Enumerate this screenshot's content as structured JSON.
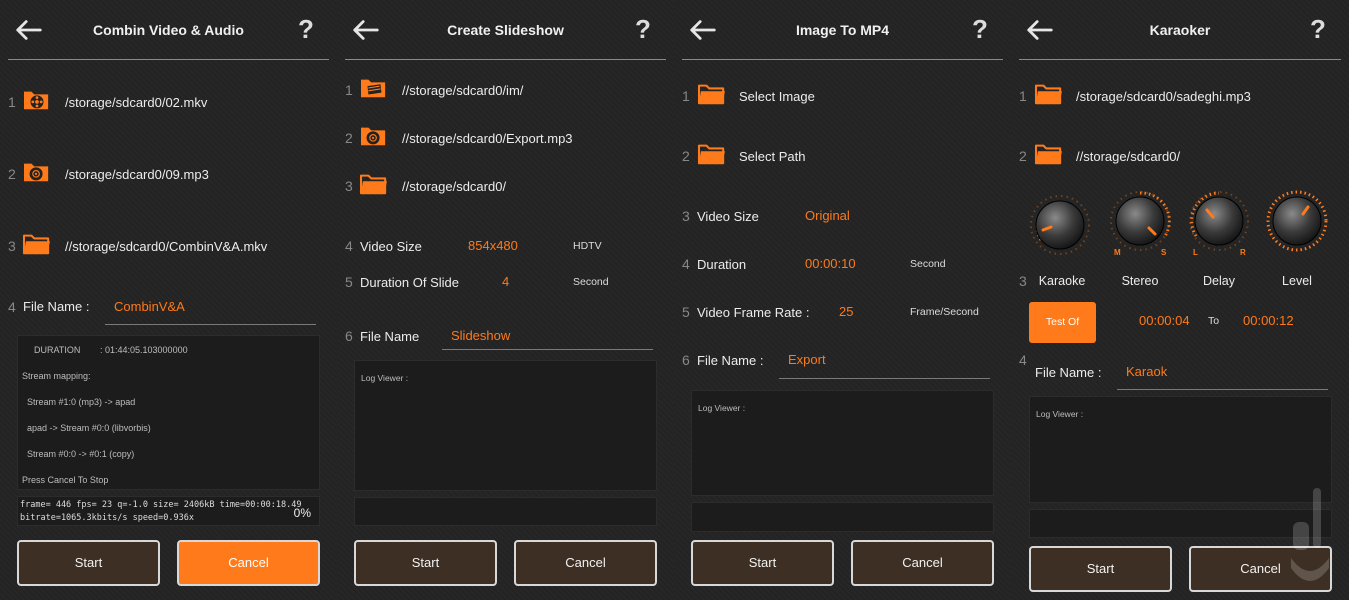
{
  "panel1": {
    "title": "Combin Video & Audio",
    "help": "?",
    "rows": [
      {
        "num": "1",
        "path": "/storage/sdcard0/02.mkv",
        "icon": "video-file-icon"
      },
      {
        "num": "2",
        "path": "/storage/sdcard0/09.mp3",
        "icon": "audio-file-icon"
      },
      {
        "num": "3",
        "path": "//storage/sdcard0/CombinV&A.mkv",
        "icon": "folder-icon"
      }
    ],
    "file_num": "4",
    "file_label": "File Name :",
    "file_value": "CombinV&A",
    "log": {
      "duration_label": "DURATION",
      "duration_value": ": 01:44:05.103000000",
      "lines": [
        "Stream mapping:",
        "Stream #1:0 (mp3) -> apad",
        "apad -> Stream #0:0 (libvorbis)",
        "Stream #0:0 -> #0:1 (copy)",
        "Press Cancel To Stop"
      ]
    },
    "progress": {
      "line1": "frame= 446 fps= 23 q=-1.0 size= 2406kB time=00:00:18.49",
      "line2": "bitrate=1065.3kbits/s speed=0.936x",
      "percent_text": "0%"
    },
    "start": "Start",
    "cancel": "Cancel"
  },
  "panel2": {
    "title": "Create Slideshow",
    "help": "?",
    "rows": [
      {
        "num": "1",
        "path": "//storage/sdcard0/im/",
        "icon": "images-stack-icon"
      },
      {
        "num": "2",
        "path": "//storage/sdcard0/Export.mp3",
        "icon": "audio-file-icon"
      },
      {
        "num": "3",
        "path": "//storage/sdcard0/",
        "icon": "folder-icon"
      }
    ],
    "video_size": {
      "num": "4",
      "label": "Video Size",
      "value": "854x480",
      "unit": "HDTV"
    },
    "slide": {
      "num": "5",
      "label": "Duration Of Slide",
      "value": "4",
      "unit": "Second"
    },
    "file_num": "6",
    "file_label": "File Name",
    "file_value": "Slideshow",
    "log_label": "Log Viewer :",
    "start": "Start",
    "cancel": "Cancel"
  },
  "panel3": {
    "title": "Image To MP4",
    "help": "?",
    "rows": [
      {
        "num": "1",
        "label": "Select Image"
      },
      {
        "num": "2",
        "label": "Select Path"
      }
    ],
    "video_size": {
      "num": "3",
      "label": "Video Size",
      "value": "Original"
    },
    "duration": {
      "num": "4",
      "label": "Duration",
      "value": "00:00:10",
      "unit": "Second"
    },
    "frame_rate": {
      "num": "5",
      "label": "Video Frame Rate :",
      "value": "25",
      "unit": "Frame/Second"
    },
    "file_num": "6",
    "file_label": "File Name :",
    "file_value": "Export",
    "log_label": "Log Viewer :",
    "start": "Start",
    "cancel": "Cancel"
  },
  "panel4": {
    "title": "Karaoker",
    "help": "?",
    "rows": [
      {
        "num": "1",
        "path": "/storage/sdcard0/sadeghi.mp3"
      },
      {
        "num": "2",
        "path": "//storage/sdcard0/"
      }
    ],
    "knobs_num": "3",
    "knobs": [
      {
        "label": "Karaoke"
      },
      {
        "label": "Stereo",
        "left_mark": "M",
        "right_mark": "S"
      },
      {
        "label": "Delay",
        "left_mark": "L",
        "right_mark": "R"
      },
      {
        "label": "Level"
      }
    ],
    "test_button": "Test Of",
    "from_time": "00:00:04",
    "to_label": "To",
    "to_time": "00:00:12",
    "file_num": "4",
    "file_label": "File Name :",
    "file_value": "Karaok",
    "log_label": "Log Viewer :",
    "start": "Start",
    "cancel": "Cancel"
  },
  "colors": {
    "accent": "#ff7a1a",
    "button_bg": "#3d2f23",
    "panel_bg": "#242424"
  }
}
